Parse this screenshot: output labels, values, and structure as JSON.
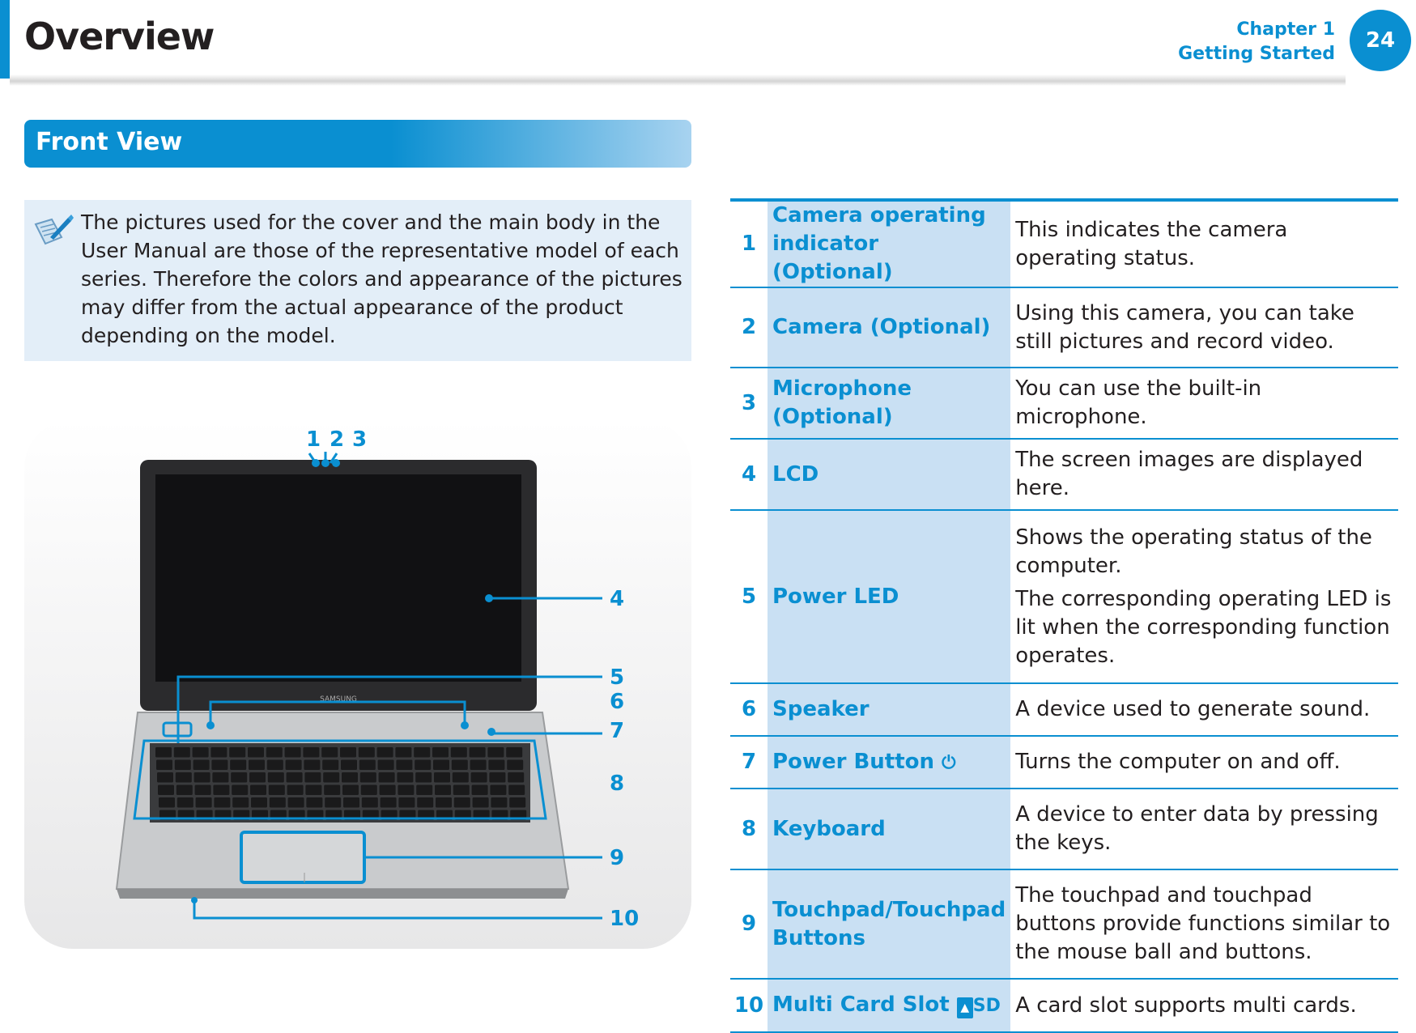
{
  "header": {
    "title": "Overview",
    "chapter": "Chapter 1",
    "chapter_title": "Getting Started",
    "page_number": "24"
  },
  "section": {
    "title": "Front View"
  },
  "note": {
    "icon": "note-pen-icon",
    "text": "The pictures used for the cover and the main body in the User Manual are those of the representative model of each series. Therefore the colors and appearance of the pictures may differ from the actual appearance of the product depending on the model."
  },
  "callouts": [
    "1",
    "2",
    "3",
    "4",
    "5",
    "6",
    "7",
    "8",
    "9",
    "10"
  ],
  "laptop_brand": "SAMSUNG",
  "accent_color": "#0a8fd1",
  "parts": [
    {
      "num": "1",
      "name": "Camera operating indicator (Optional)",
      "desc": [
        "This indicates the camera operating status."
      ]
    },
    {
      "num": "2",
      "name": "Camera (Optional)",
      "desc": [
        "Using this camera, you can take still pictures and record video."
      ]
    },
    {
      "num": "3",
      "name": "Microphone (Optional)",
      "desc": [
        "You can use the built-in microphone."
      ]
    },
    {
      "num": "4",
      "name": "LCD",
      "desc": [
        "The screen images are displayed here."
      ]
    },
    {
      "num": "5",
      "name": "Power LED",
      "desc": [
        "Shows the operating status of the computer.",
        "The corresponding operating LED is lit when the corresponding function operates."
      ]
    },
    {
      "num": "6",
      "name": "Speaker",
      "desc": [
        "A device used to generate sound."
      ]
    },
    {
      "num": "7",
      "name": "Power Button",
      "icon": "power-icon",
      "desc": [
        "Turns the computer on and off."
      ]
    },
    {
      "num": "8",
      "name": "Keyboard",
      "desc": [
        "A device to enter data by pressing the keys."
      ]
    },
    {
      "num": "9",
      "name": "Touchpad/Touchpad Buttons",
      "desc": [
        "The touchpad and touchpad buttons provide functions similar to the mouse ball and buttons."
      ]
    },
    {
      "num": "10",
      "name": "Multi Card Slot",
      "icon": "sd-card-icon",
      "icon_label": "SD",
      "desc": [
        "A card slot supports multi cards."
      ]
    }
  ]
}
